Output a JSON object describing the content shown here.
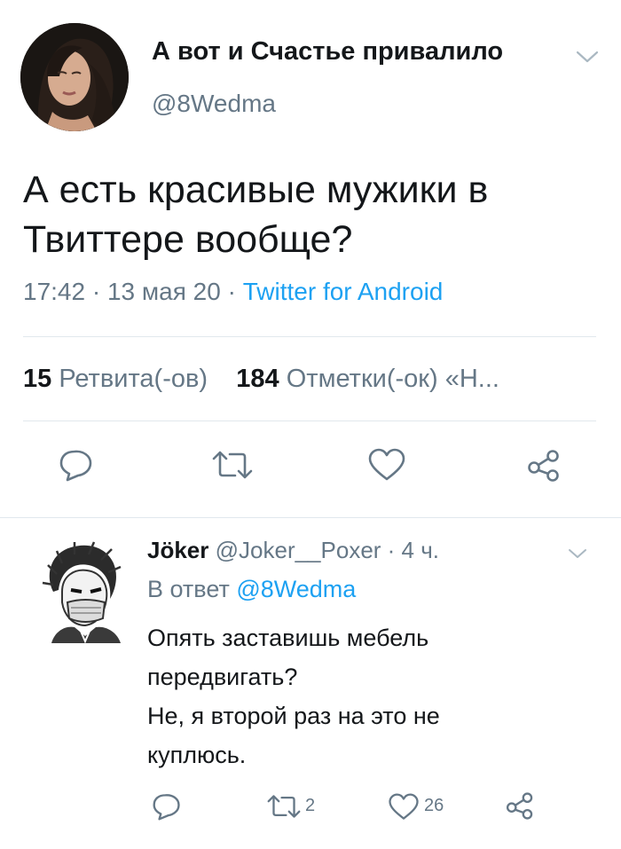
{
  "main_tweet": {
    "display_name": "А вот и Счастье привалило",
    "handle": "@8Wedma",
    "text_line1": "А есть красивые мужики в",
    "text_line2": "Твиттере вообще?",
    "time": "17:42",
    "date": "13 мая 20",
    "source": "Twitter for Android",
    "separator": " · ",
    "retweets_count": "15",
    "retweets_label": "Ретвита(-ов)",
    "likes_count": "184",
    "likes_label": "Отметки(-ок)",
    "quotes_label": "«Н..."
  },
  "reply_tweet": {
    "display_name": "Jöker",
    "handle": "@Joker__Poxer",
    "age": "4 ч.",
    "reply_prefix": "В ответ",
    "reply_mention": "@8Wedma",
    "text_line1": "Опять заставишь мебель",
    "text_line2": "передвигать?",
    "text_line3": "Не, я второй раз на это не",
    "text_line4": "куплюсь.",
    "retweet_count": "2",
    "like_count": "26"
  },
  "icons": {
    "reply": "reply-bubble-icon",
    "retweet": "retweet-arrows-icon",
    "like": "heart-icon",
    "share": "share-icon",
    "caret": "chevron-down-icon"
  },
  "colors": {
    "text": "#14171a",
    "secondary": "#657786",
    "link": "#1da1f2",
    "divider": "#e1e8ed",
    "background": "#ffffff"
  }
}
